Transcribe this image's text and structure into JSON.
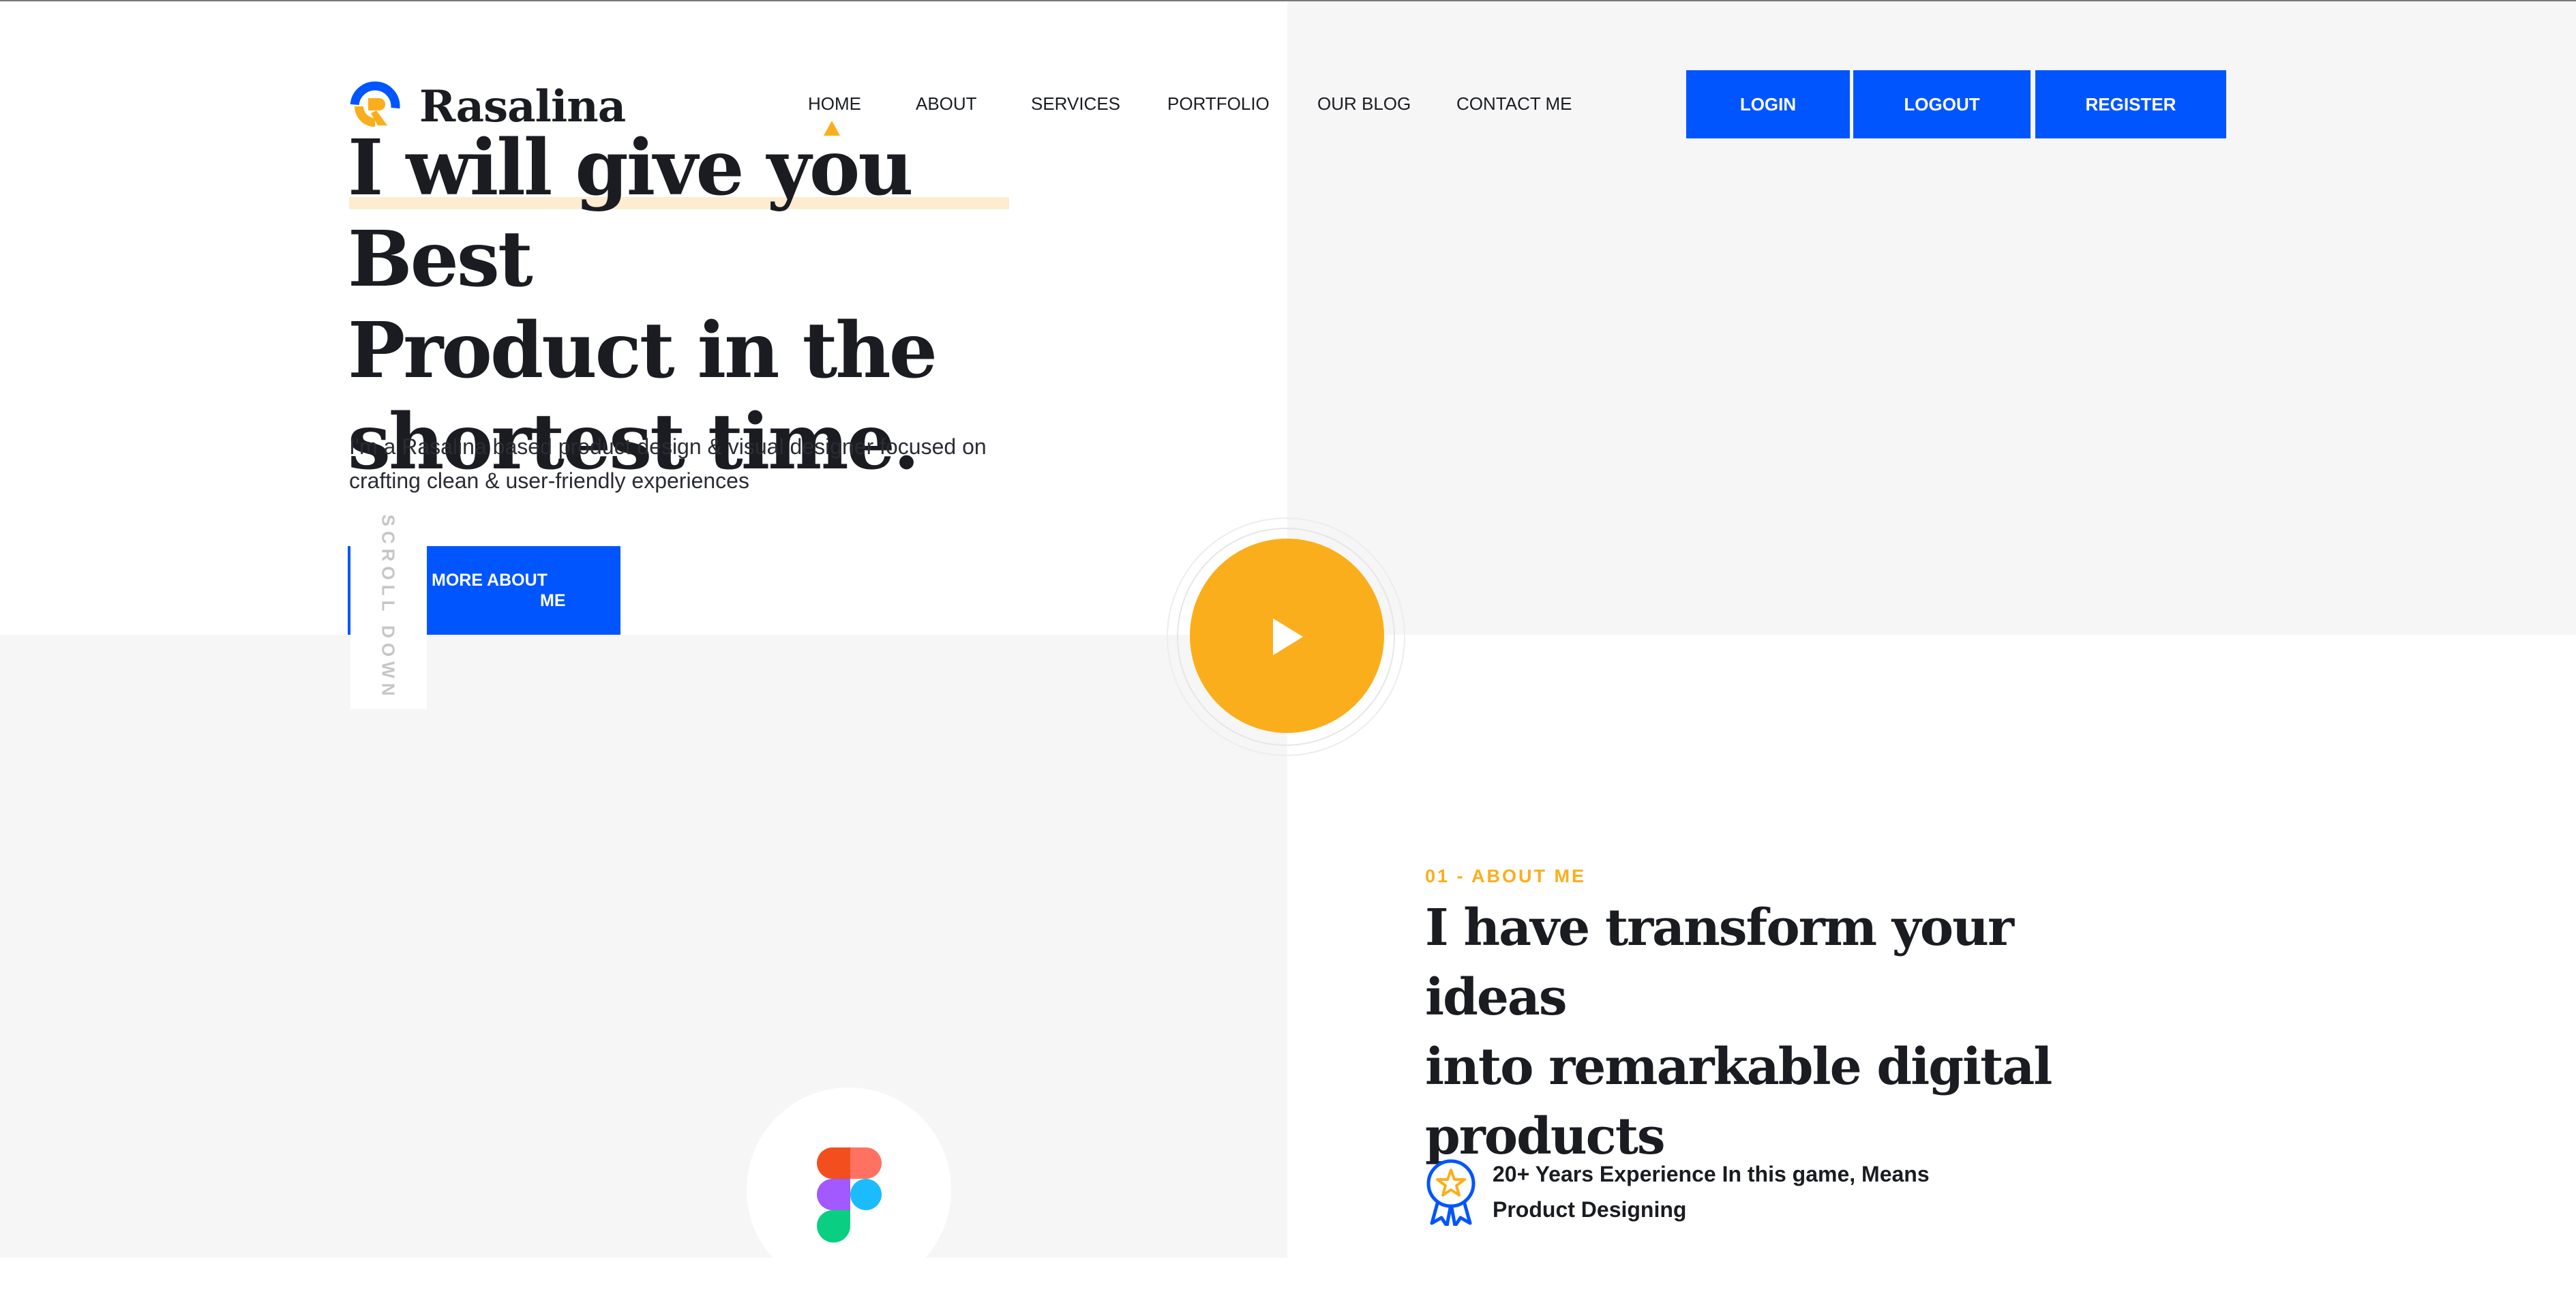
{
  "brand": {
    "name": "Rasalina"
  },
  "nav": {
    "items": [
      {
        "label": "HOME",
        "active": true
      },
      {
        "label": "ABOUT"
      },
      {
        "label": "SERVICES"
      },
      {
        "label": "PORTFOLIO"
      },
      {
        "label": "OUR BLOG"
      },
      {
        "label": "CONTACT ME"
      }
    ]
  },
  "auth": {
    "login": "LOGIN",
    "logout": "LOGOUT",
    "register": "REGISTER"
  },
  "hero": {
    "title_line1": "I will give you Best",
    "title_line2": "Product in the",
    "title_line3": "shortest time.",
    "desc_line1": "I'm a Rasalina based product design & visual designer focused on",
    "desc_line2": "crafting clean & user-friendly experiences",
    "button_line1": "MORE ABOUT",
    "button_line2": "ME",
    "scroll_label": "SCROLL DOWN"
  },
  "about": {
    "tag": "01 - ABOUT ME",
    "title_line1": "I have transform your ideas",
    "title_line2": "into remarkable digital",
    "title_line3": "products",
    "experience_line1": "20+ Years Experience In this game, Means",
    "experience_line2": "Product Designing"
  },
  "icons": {
    "logo": "rasalina-logo-icon",
    "play": "play-icon",
    "figma": "figma-icon",
    "badge": "award-badge-icon"
  },
  "colors": {
    "primary": "#0055ff",
    "accent": "#fbae1c",
    "heading": "#1a1c22",
    "section_bg": "#f6f6f6"
  }
}
